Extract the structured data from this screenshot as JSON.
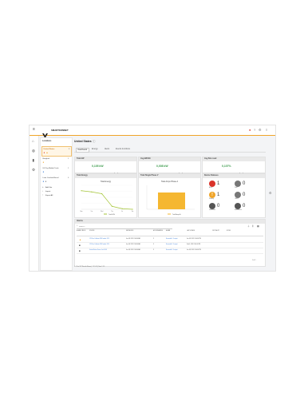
{
  "header": {
    "app_name": "SMARTKONNET",
    "logo_icon": "v-logo-icon",
    "help_label": "Help",
    "user_status_color": "#e8a33a"
  },
  "sidebar": {
    "title": "Locations",
    "items": [
      {
        "label": "United States",
        "count": "3"
      },
      {
        "label": "Bangkok",
        "count": "1"
      },
      {
        "label": "UK Dry Mobile Trials",
        "count": "1"
      },
      {
        "label": "Lime Cracked Barrel",
        "count": "0"
      }
    ],
    "actions": [
      {
        "label": "Add Site",
        "icon": "plus-icon"
      },
      {
        "label": "Import",
        "icon": "import-icon"
      },
      {
        "label": "Export All",
        "icon": "export-icon"
      }
    ]
  },
  "page": {
    "title": "United States",
    "tabs": [
      "Dashboard",
      "Energy",
      "Alerts",
      "Events & Actions"
    ],
    "active_tab": "Dashboard"
  },
  "kpis": [
    {
      "title": "Total kW",
      "value": "0,105 kW"
    },
    {
      "title": "Avg kWh/Hr",
      "value": "0,008 kW"
    },
    {
      "title": "Avg Site Load",
      "value": "0,107%"
    }
  ],
  "total_energy": {
    "header": "Total Energy",
    "chart_title": "Total Energy",
    "legend": "Total kWh",
    "color": "#a6c63a"
  },
  "phase_panel": {
    "header": "Total Single Phase V",
    "chart_title": "Total Amps Phase A",
    "legend": "Total Amps A",
    "color": "#f5b731"
  },
  "chart_data": [
    {
      "type": "line",
      "x": [
        "Mon",
        "Tue",
        "Wed",
        "Thu",
        "Fri",
        "Sat"
      ],
      "series": [
        {
          "values": [
            31,
            29,
            26,
            5,
            1,
            0
          ]
        }
      ],
      "ylim": [
        0,
        40
      ]
    },
    {
      "type": "bar",
      "x": [
        "Phase A"
      ],
      "series": [
        {
          "values": [
            35
          ]
        }
      ],
      "ylim": [
        0,
        50
      ]
    }
  ],
  "status_summary": {
    "header": "Device Statuses",
    "items": [
      {
        "label": "Alarm",
        "count": "1",
        "color": "#d9342b",
        "icon": "alarm-icon"
      },
      {
        "label": "Fault",
        "count": "0",
        "color": "#777777",
        "icon": "fault-icon"
      },
      {
        "label": "Warning",
        "count": "1",
        "color": "#f0a52a",
        "icon": "warning-icon"
      },
      {
        "label": "Offline",
        "count": "0",
        "color": "#777777",
        "icon": "offline-icon"
      },
      {
        "label": "Information",
        "count": "0",
        "color": "#555555",
        "icon": "info-icon"
      },
      {
        "label": "Maintenance",
        "count": "0",
        "color": "#555555",
        "icon": "maintenance-icon"
      }
    ]
  },
  "alarms": {
    "header": "Alarms",
    "search_placeholder": "Search...",
    "columns": [
      "ALARM STATUS",
      "SOURCE",
      "DATE ACKED",
      "ACK REMAINING",
      "ALARM",
      "LAST UPDATE",
      "CRITICALITY",
      "NOTES"
    ],
    "rows": [
      {
        "status_color": "#f0a52a",
        "source": "123 Fun Calibrate PM4 nodes 12/3",
        "date": "Jun 08, 2020 7:00:00 AM",
        "remaining": "3",
        "alarm": "Exceeded 1.3 output",
        "update": "Jun 08, 2020 7:00:00 PM"
      },
      {
        "status_color": "#555555",
        "source": "123 Fun Calibrate PM4 nodes 12/4",
        "date": "Jun 08, 2020 7:00:00 AM",
        "remaining": "3",
        "alarm": "Exceeded 1.3 output",
        "update": "Feb 4, 2020 1:00:00 PM"
      },
      {
        "status_color": "#555555",
        "source": "United States Demo 4 m 66 66",
        "date": "Jun 08, 2020 7:00:00 AM",
        "remaining": "3",
        "alarm": "Exceeded 1.3 output",
        "update": "Jun 08, 2020 7:00:00 PM"
      }
    ],
    "footer": "1 - 25 of 127 Results Shown | 1 2 3 4 5 | Next 1 2 3",
    "pagination": "1 of 1",
    "toolbar_icons": [
      "filter-icon",
      "columns-icon",
      "grid-icon"
    ]
  },
  "right_rail": {
    "settings_icon": "gear-icon"
  }
}
